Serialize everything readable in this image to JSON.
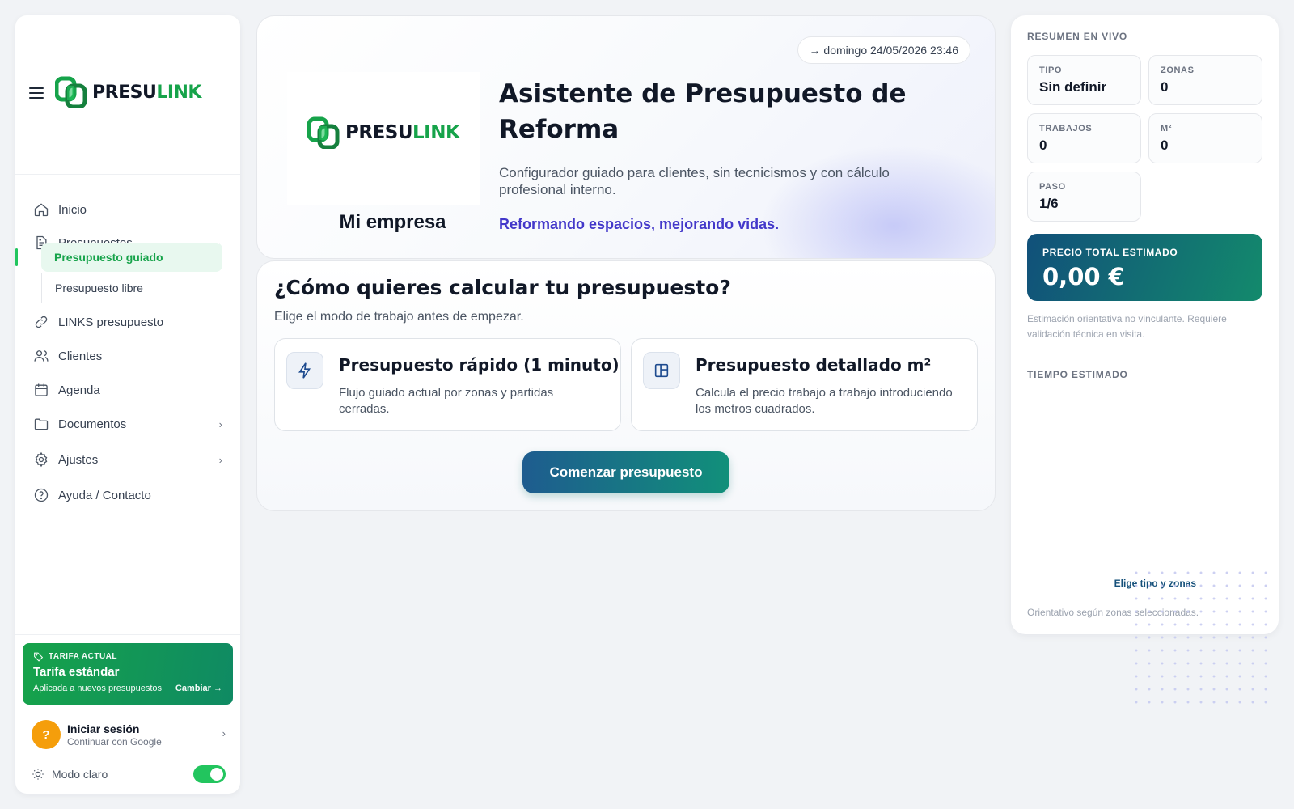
{
  "brand": {
    "part1": "PRESU",
    "part2": "LINK"
  },
  "nav": {
    "inicio": "Inicio",
    "presupuestos": "Presupuestos",
    "presupuesto_guiado": "Presupuesto guiado",
    "presupuesto_libre": "Presupuesto libre",
    "links": "LINKS presupuesto",
    "clientes": "Clientes",
    "agenda": "Agenda",
    "documentos": "Documentos",
    "ajustes": "Ajustes",
    "ayuda": "Ayuda / Contacto"
  },
  "tarifa": {
    "kicker": "TARIFA ACTUAL",
    "title": "Tarifa estándar",
    "desc": "Aplicada a nuevos presupuestos",
    "action": "Cambiar →"
  },
  "login": {
    "title": "Iniciar sesión",
    "subtitle": "Continuar con Google",
    "avatar": "?"
  },
  "theme": {
    "label": "Modo claro",
    "enabled": true
  },
  "hero": {
    "date": "→ domingo 24/05/2026 23:46",
    "company": "Mi empresa",
    "title": "Asistente de Presupuesto de Reforma",
    "description": "Configurador guiado para clientes, sin tecnicismos y con cálculo profesional interno.",
    "tagline": "Reformando espacios, mejorando vidas."
  },
  "mode": {
    "title": "¿Cómo quieres calcular tu presupuesto?",
    "subtitle": "Elige el modo de trabajo antes de empezar.",
    "options": [
      {
        "title": "Presupuesto rápido (1 minuto)",
        "desc": "Flujo guiado actual por zonas y partidas cerradas.",
        "icon": "lightning-icon"
      },
      {
        "title": "Presupuesto detallado m²",
        "desc": "Calcula el precio trabajo a trabajo introduciendo los metros cuadrados.",
        "icon": "layout-icon"
      }
    ],
    "start": "Comenzar presupuesto"
  },
  "summary": {
    "heading": "RESUMEN EN VIVO",
    "stats": {
      "tipo": {
        "label": "TIPO",
        "value": "Sin definir"
      },
      "zonas": {
        "label": "ZONAS",
        "value": "0"
      },
      "trabajos": {
        "label": "TRABAJOS",
        "value": "0"
      },
      "m2": {
        "label": "M²",
        "value": "0"
      },
      "paso": {
        "label": "PASO",
        "value": "1/6"
      }
    },
    "price_label": "PRECIO TOTAL ESTIMADO",
    "price_value": "0,00 €",
    "note": "Estimación orientativa no vinculante. Requiere validación técnica en visita.",
    "time_heading": "TIEMPO ESTIMADO",
    "pick": "Elige tipo y zonas",
    "orient": "Orientativo según zonas seleccionadas."
  },
  "colors": {
    "accent_green": "#16a34a",
    "accent_indigo": "#4338ca",
    "brand_dark": "#111827"
  }
}
